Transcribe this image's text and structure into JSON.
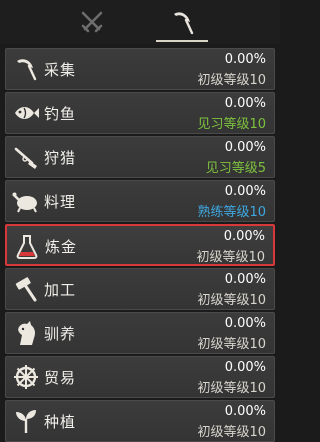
{
  "tabs": [
    {
      "icon": "crossed-swords-icon",
      "active": false
    },
    {
      "icon": "sickle-icon",
      "active": true
    }
  ],
  "skills": [
    {
      "name": "采集",
      "percent": "0.00%",
      "level": "初级等级10",
      "level_color": "default",
      "icon": "sickle-icon"
    },
    {
      "name": "钓鱼",
      "percent": "0.00%",
      "level": "见习等级10",
      "level_color": "green",
      "icon": "fish-icon"
    },
    {
      "name": "狩猎",
      "percent": "0.00%",
      "level": "见习等级5",
      "level_color": "green",
      "icon": "musket-icon"
    },
    {
      "name": "料理",
      "percent": "0.00%",
      "level": "熟练等级10",
      "level_color": "blue",
      "icon": "roast-chicken-icon"
    },
    {
      "name": "炼金",
      "percent": "0.00%",
      "level": "初级等级10",
      "level_color": "default",
      "icon": "flask-icon",
      "selected": true
    },
    {
      "name": "加工",
      "percent": "0.00%",
      "level": "初级等级10",
      "level_color": "default",
      "icon": "hammer-icon"
    },
    {
      "name": "驯养",
      "percent": "0.00%",
      "level": "初级等级10",
      "level_color": "default",
      "icon": "horse-head-icon"
    },
    {
      "name": "贸易",
      "percent": "0.00%",
      "level": "初级等级10",
      "level_color": "default",
      "icon": "ship-wheel-icon"
    },
    {
      "name": "种植",
      "percent": "0.00%",
      "level": "初级等级10",
      "level_color": "default",
      "icon": "sprout-icon"
    }
  ],
  "colors": {
    "selected_border": "#d9383a",
    "green_level": "#7ec13f",
    "blue_level": "#3ea7e0"
  }
}
